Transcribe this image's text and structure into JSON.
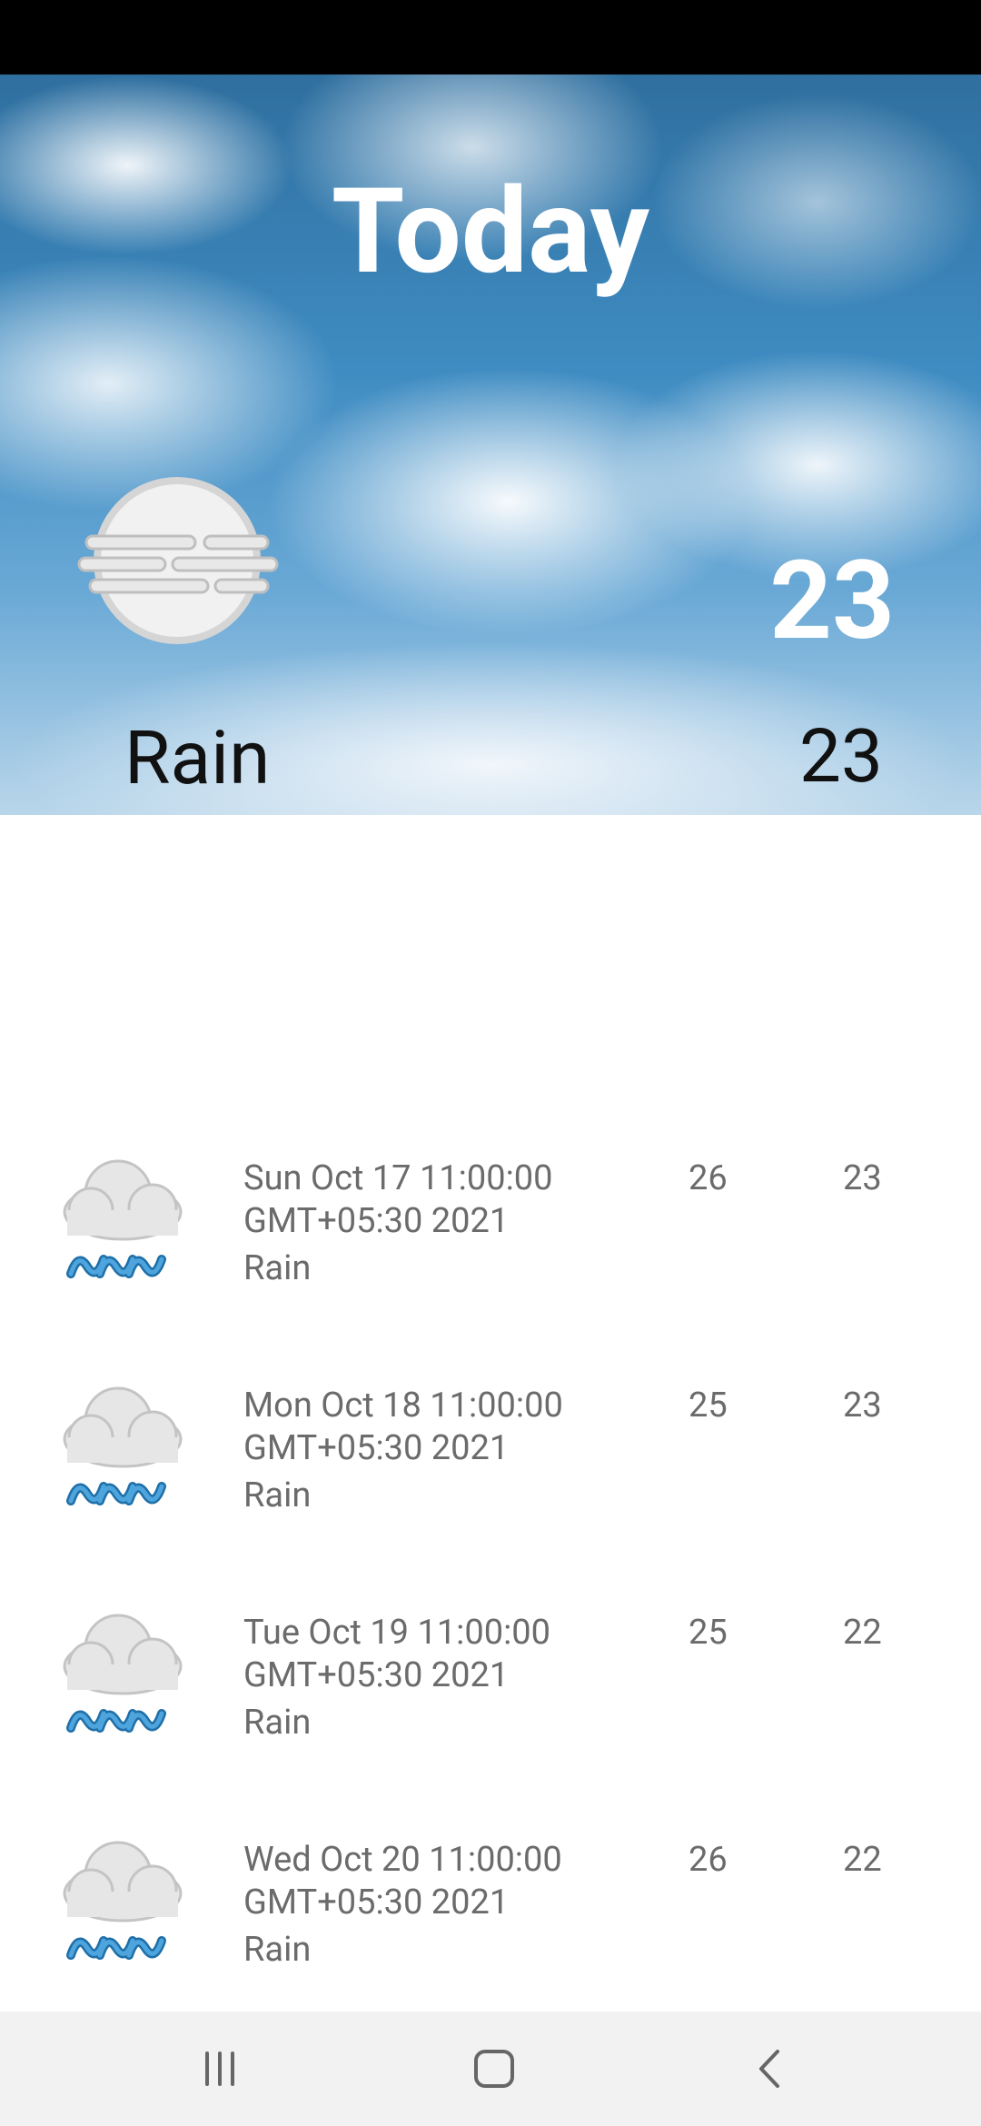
{
  "header": {
    "title": "Today",
    "condition": "Rain",
    "temp_main": "23",
    "temp_secondary": "23",
    "icon": "fog-icon"
  },
  "forecast": [
    {
      "date": "Sun Oct 17 11:00:00 GMT+05:30 2021",
      "desc": "Rain",
      "high": "26",
      "low": "23",
      "icon": "rain-cloud-icon"
    },
    {
      "date": "Mon Oct 18 11:00:00 GMT+05:30 2021",
      "desc": "Rain",
      "high": "25",
      "low": "23",
      "icon": "rain-cloud-icon"
    },
    {
      "date": "Tue Oct 19 11:00:00 GMT+05:30 2021",
      "desc": "Rain",
      "high": "25",
      "low": "22",
      "icon": "rain-cloud-icon"
    },
    {
      "date": "Wed Oct 20 11:00:00 GMT+05:30 2021",
      "desc": "Rain",
      "high": "26",
      "low": "22",
      "icon": "rain-cloud-icon"
    }
  ],
  "navigation": {
    "recents": "recents-icon",
    "home": "home-icon",
    "back": "back-icon"
  },
  "colors": {
    "status_bar": "#000000",
    "nav_bar": "#f2f2f2",
    "secondary_text": "#6b6b6b",
    "rain_blue": "#2f88c6"
  }
}
